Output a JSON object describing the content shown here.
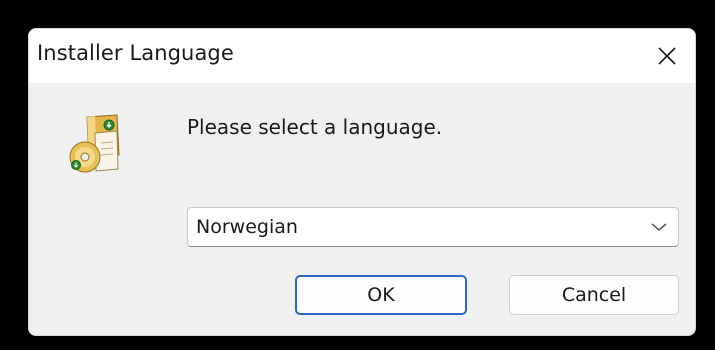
{
  "window": {
    "title": "Installer Language",
    "close_icon": "close-icon"
  },
  "content": {
    "icon": "installer-icon",
    "prompt": "Please select a language."
  },
  "language_select": {
    "selected": "Norwegian",
    "chevron_icon": "chevron-down-icon"
  },
  "buttons": {
    "ok_label": "OK",
    "cancel_label": "Cancel"
  },
  "colors": {
    "dialog_background": "#f0f0f0",
    "titlebar_background": "#ffffff",
    "focus_border": "#2f67c8",
    "screen_background": "#000000"
  }
}
